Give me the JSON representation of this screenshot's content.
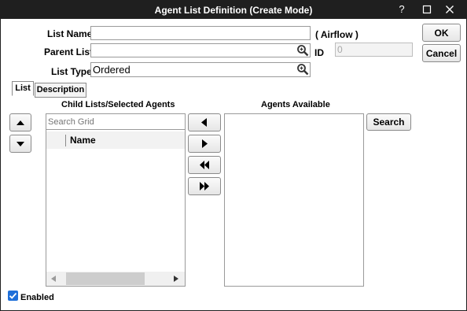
{
  "window": {
    "title": "Agent List Definition (Create Mode)",
    "help_label": "?"
  },
  "form": {
    "list_name_label": "List Name",
    "list_name_value": "",
    "list_name_suffix": "( Airflow )",
    "parent_list_label": "Parent List",
    "parent_list_value": "",
    "id_label": "ID",
    "id_value": "0",
    "list_type_label": "List Type",
    "list_type_value": "Ordered"
  },
  "buttons": {
    "ok": "OK",
    "cancel": "Cancel",
    "search": "Search"
  },
  "tabs": [
    {
      "label": "List",
      "active": true
    },
    {
      "label": "Description",
      "active": false
    }
  ],
  "child_lists": {
    "heading": "Child Lists/Selected Agents",
    "search_placeholder": "Search Grid",
    "column_header": "Name",
    "rows": []
  },
  "agents_available": {
    "heading": "Agents Available",
    "rows": []
  },
  "enabled": {
    "label": "Enabled",
    "checked": true
  },
  "colors": {
    "titlebar": "#1f1f1f",
    "checkbox": "#1e6fd9"
  }
}
